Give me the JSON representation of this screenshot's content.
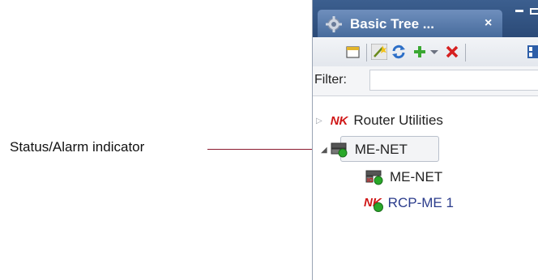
{
  "callout": {
    "label": "Status/Alarm indicator"
  },
  "tab": {
    "title": "Basic Tree ...",
    "close": "×",
    "icon": "gear-icon"
  },
  "window_controls": [
    "minimize-icon",
    "maximize-icon"
  ],
  "toolbar": {
    "buttons": [
      "new-window-icon",
      "wand-icon",
      "refresh-icon",
      "add-icon",
      "dropdown-icon",
      "delete-icon",
      "layout-icon"
    ]
  },
  "filter": {
    "label": "Filter:",
    "value": "",
    "placeholder": ""
  },
  "tree": {
    "nodes": [
      {
        "label": "Router Utilities",
        "badge": "NK",
        "expanded": false
      },
      {
        "label": "ME-NET",
        "expanded": true,
        "selected": true
      },
      {
        "label": "ME-NET"
      },
      {
        "label": "RCP-ME 1",
        "badge": "NK"
      }
    ]
  },
  "colors": {
    "callout_line": "#8b1a2e",
    "tab_bg": "#476b9c",
    "nk_red": "#d01818",
    "link_blue": "#2b3c8c",
    "status_green": "#29a829"
  }
}
